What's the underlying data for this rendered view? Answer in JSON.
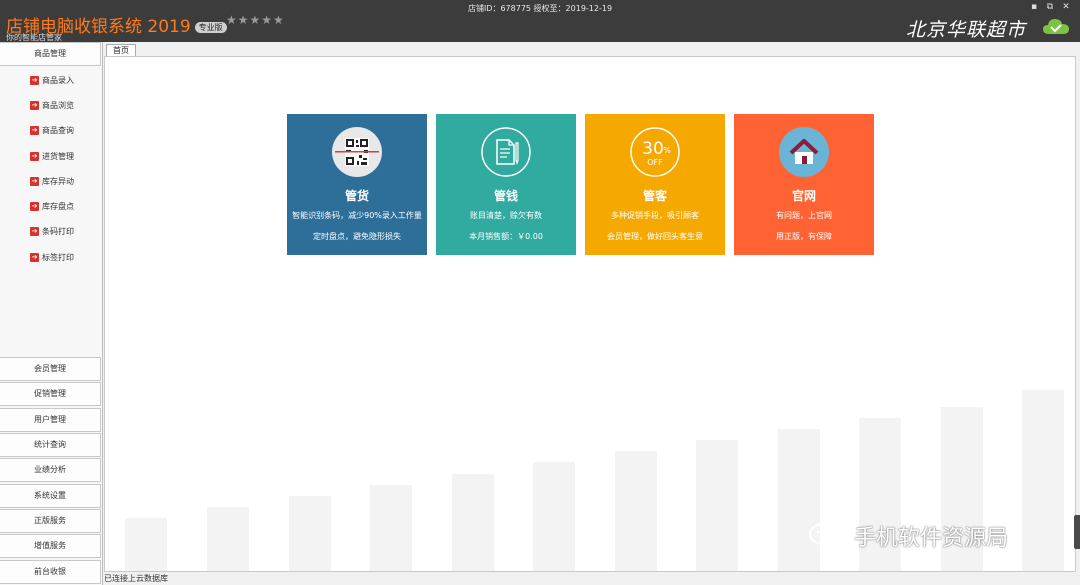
{
  "titlebar": {
    "app_title": "店铺电脑收银系统 2019",
    "edition": "专业版",
    "stars": "★★★★★",
    "subtitle": "你的智能店管家",
    "store_info": "店铺ID：678775 授权至：2019-12-19",
    "brand": "北京华联超市",
    "minimize": "▪",
    "restore": "⧉",
    "close": "✕"
  },
  "sidebar": {
    "top_group": "商品管理",
    "sub_items": [
      "商品录入",
      "商品浏览",
      "商品查询",
      "进货管理",
      "库存异动",
      "库存盘点",
      "条码打印",
      "标签打印"
    ],
    "groups": [
      "会员管理",
      "促销管理",
      "用户管理",
      "统计查询",
      "业绩分析",
      "系统设置",
      "正版服务",
      "增值服务",
      "前台收银"
    ]
  },
  "tabs": {
    "home": "首页"
  },
  "cards": [
    {
      "title": "管货",
      "line1": "智能识别条码，减少90%录入工作量",
      "line2": "定时盘点，避免隐形损失",
      "color": "#2e6f9a",
      "icon": "qr-scan-icon"
    },
    {
      "title": "管钱",
      "line1": "账目清楚，赊欠有数",
      "line2": "本月销售额：￥0.00",
      "color": "#31aba0",
      "icon": "document-pen-icon"
    },
    {
      "title": "管客",
      "line1": "多种促销手段，吸引顾客",
      "line2": "会员管理，做好回头客生意",
      "color": "#f5a800",
      "icon": "discount-30-off-icon",
      "icon_text_big": "30",
      "icon_text_pct": "%",
      "icon_text_small": "OFF"
    },
    {
      "title": "官网",
      "line1": "有问题，上官网",
      "line2": "用正版，有保障",
      "color": "#ff6333",
      "icon": "home-icon"
    }
  ],
  "status": {
    "text": "已连接上云数据库"
  },
  "watermark": {
    "text": "手机软件资源局"
  },
  "colors": {
    "titlebar": "#3c3c3c",
    "title_orange": "#ff7a1a",
    "arrow_red": "#d9322e",
    "bar_gray": "#f3f3f3"
  }
}
